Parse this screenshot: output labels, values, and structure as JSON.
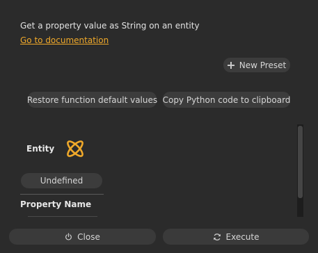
{
  "header": {
    "description": "Get a property value as String on an entity",
    "doc_link": "Go to documentation"
  },
  "toolbar": {
    "new_preset_label": "New Preset",
    "restore_label": "Restore function default values",
    "copy_label": "Copy Python code to clipboard"
  },
  "params": {
    "entity_label": "Entity",
    "entity_value": "Undefined",
    "property_name_label": "Property Name"
  },
  "footer": {
    "close_label": "Close",
    "execute_label": "Execute"
  },
  "colors": {
    "accent": "#f0a92a",
    "background": "#2b2b2b",
    "button": "#3c3c3c"
  },
  "icons": {
    "new_preset": "plus-icon",
    "entity": "entity-icon",
    "close": "power-icon",
    "execute": "refresh-icon"
  }
}
